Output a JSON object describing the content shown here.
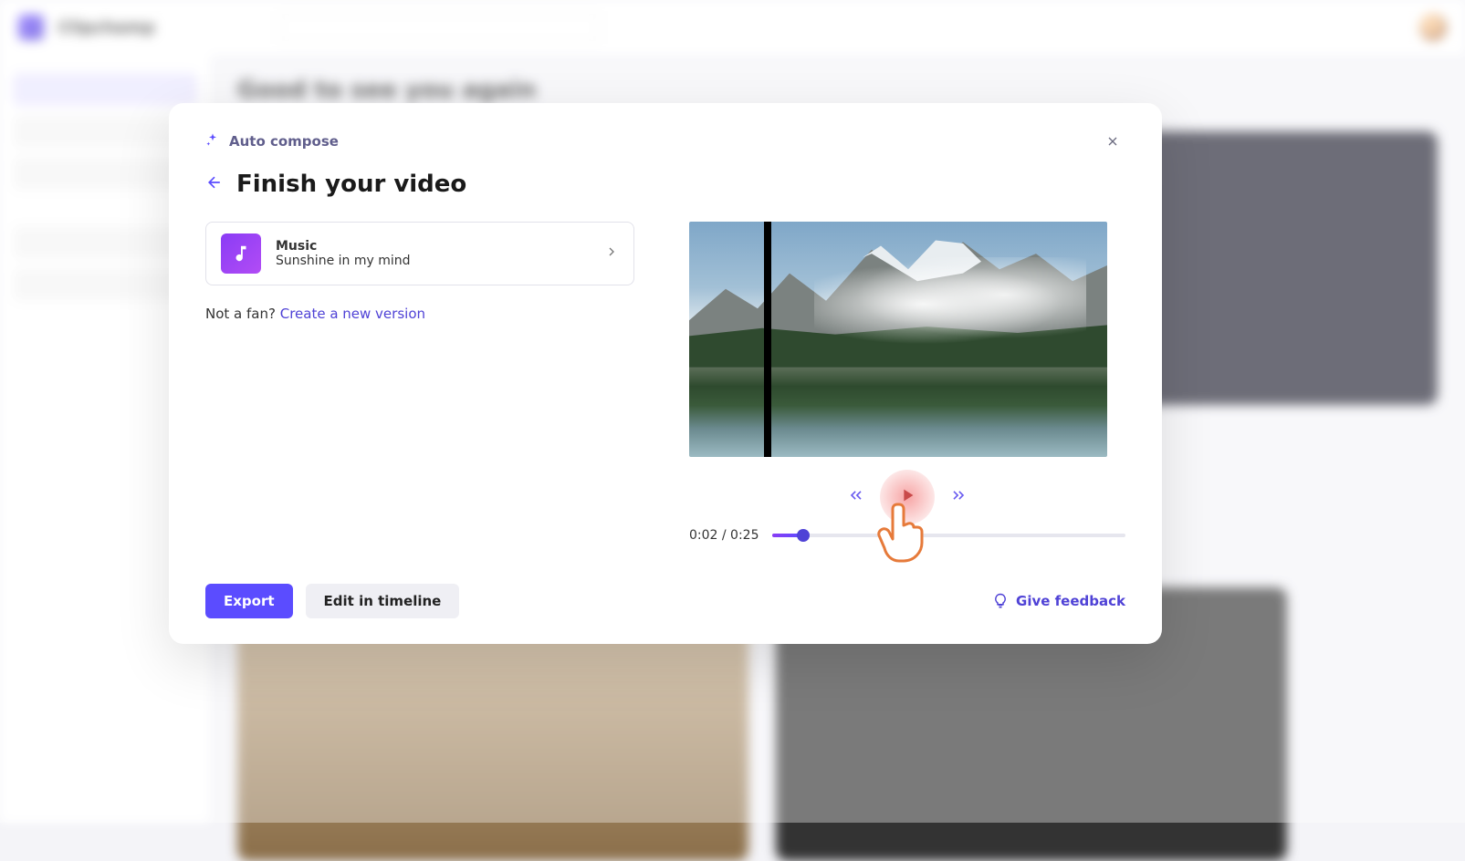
{
  "bg": {
    "brand": "Clipchamp",
    "greeting": "Good to see you again"
  },
  "modal": {
    "badge": "Auto compose",
    "title": "Finish your video",
    "music": {
      "label": "Music",
      "track": "Sunshine in my mind"
    },
    "regen_prefix": "Not a fan? ",
    "regen_link": "Create a new version",
    "time": "0:02 / 0:25",
    "export": "Export",
    "edit": "Edit in timeline",
    "feedback": "Give feedback"
  }
}
